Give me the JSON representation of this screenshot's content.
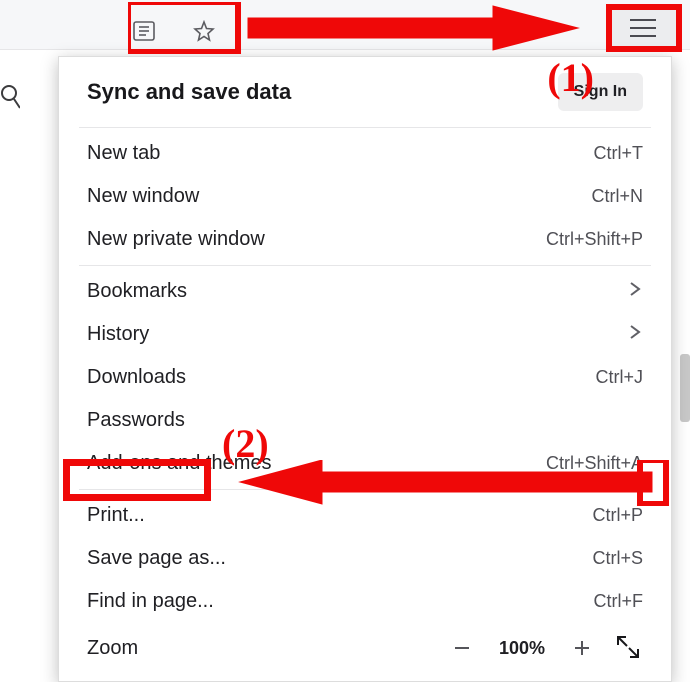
{
  "toolbar": {
    "icons": [
      "reading-list-icon",
      "bookmark-star-icon",
      "hamburger-menu-icon"
    ]
  },
  "annotations": {
    "step1": "(1)",
    "step2": "(2)"
  },
  "menu": {
    "header_title": "Sync and save data",
    "signin_label": "Sign In",
    "items1": [
      {
        "label": "New tab",
        "shortcut": "Ctrl+T"
      },
      {
        "label": "New window",
        "shortcut": "Ctrl+N"
      },
      {
        "label": "New private window",
        "shortcut": "Ctrl+Shift+P"
      }
    ],
    "items2": [
      {
        "label": "Bookmarks",
        "submenu": true
      },
      {
        "label": "History",
        "submenu": true
      },
      {
        "label": "Downloads",
        "shortcut": "Ctrl+J"
      },
      {
        "label": "Passwords"
      },
      {
        "label": "Add-ons and themes",
        "shortcut": "Ctrl+Shift+A"
      }
    ],
    "items3": [
      {
        "label": "Print...",
        "shortcut": "Ctrl+P"
      },
      {
        "label": "Save page as...",
        "shortcut": "Ctrl+S"
      },
      {
        "label": "Find in page...",
        "shortcut": "Ctrl+F"
      }
    ],
    "zoom": {
      "label": "Zoom",
      "value": "100%"
    }
  }
}
